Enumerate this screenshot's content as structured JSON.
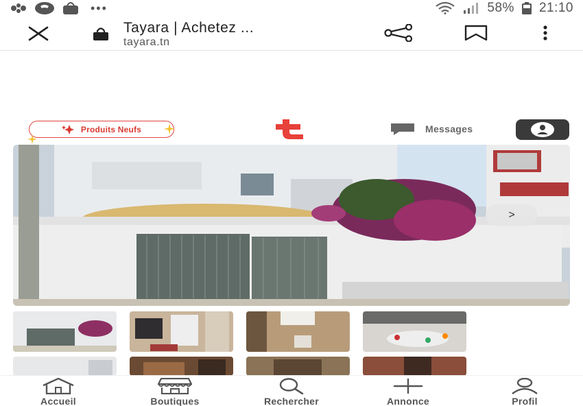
{
  "status_bar": {
    "battery": "58%",
    "time": "21:10",
    "more": "•••",
    "icons": [
      "notification-app-icon",
      "phone-icon",
      "bag-icon",
      "wifi-icon",
      "signal-icon",
      "battery-icon"
    ]
  },
  "browser": {
    "title": "Tayara | Achetez ...",
    "url": "tayara.tn",
    "icons": [
      "close-icon",
      "lock-icon",
      "share-icon",
      "bookmark-icon",
      "more-vert-icon"
    ]
  },
  "site_header": {
    "produits_label": "Produits Neufs",
    "logo_letter": "t",
    "messages_label": "Messages",
    "colors": {
      "brand": "#e8403a",
      "pill_text": "#d93a30",
      "profile_bg": "#3a3a3a"
    }
  },
  "gallery": {
    "next_label": ">",
    "thumbnail_count_visible": 8
  },
  "bottom_nav": {
    "items": [
      {
        "label": "Accueil",
        "icon": "home-icon"
      },
      {
        "label": "Boutiques",
        "icon": "store-icon"
      },
      {
        "label": "Rechercher",
        "icon": "search-icon"
      },
      {
        "label": "Annonce",
        "icon": "plus-icon"
      },
      {
        "label": "Profil",
        "icon": "user-icon"
      }
    ]
  }
}
